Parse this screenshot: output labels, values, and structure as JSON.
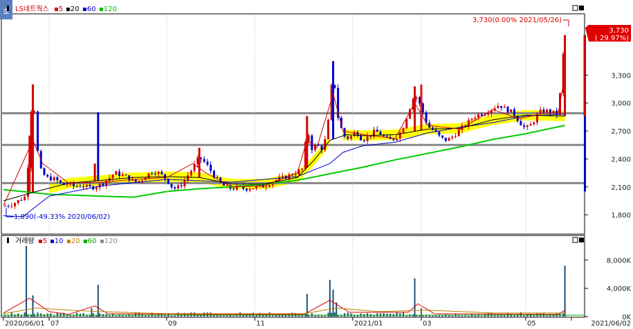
{
  "chart_data": [
    {
      "type": "candlestick",
      "title": "LS네트웍스",
      "legend": [
        {
          "label": "LS네트웍스",
          "color": "#d40000"
        },
        {
          "label": "5",
          "color": "#d40000"
        },
        {
          "label": "20",
          "color": "#000000"
        },
        {
          "label": "60",
          "color": "#0000cc"
        },
        {
          "label": "120",
          "color": "#00bb00"
        }
      ],
      "ylim": [
        1600,
        3950
      ],
      "yticks": [
        {
          "label": "3,300",
          "value": 3300
        },
        {
          "label": "3,000",
          "value": 3000
        },
        {
          "label": "2,700",
          "value": 2700
        },
        {
          "label": "2,400",
          "value": 2400
        },
        {
          "label": "2,100",
          "value": 2100
        },
        {
          "label": "1,800",
          "value": 1800
        }
      ],
      "last_price": {
        "value": "3,730",
        "change": "( 29.97%)",
        "numeric": 3730
      },
      "max_annotation": "3,730(0.00% 2021/05/26)",
      "min_annotation": "1,890(-49.33% 2020/06/02)",
      "horizontal_lines": [
        2890,
        2550,
        2140
      ],
      "price_path": [
        [
          0,
          1890
        ],
        [
          3,
          1920
        ],
        [
          7,
          2000
        ],
        [
          8,
          2650
        ],
        [
          9,
          3200
        ],
        [
          10,
          2650
        ],
        [
          11,
          2300
        ],
        [
          13,
          2200
        ],
        [
          16,
          2180
        ],
        [
          18,
          2120
        ],
        [
          20,
          2130
        ],
        [
          22,
          2100
        ],
        [
          24,
          2120
        ],
        [
          26,
          2090
        ],
        [
          28,
          2100
        ],
        [
          30,
          2130
        ],
        [
          32,
          2180
        ],
        [
          34,
          2250
        ],
        [
          36,
          2230
        ],
        [
          38,
          2200
        ],
        [
          40,
          2150
        ],
        [
          42,
          2170
        ],
        [
          44,
          2230
        ],
        [
          46,
          2270
        ],
        [
          48,
          2240
        ],
        [
          50,
          2180
        ],
        [
          52,
          2080
        ],
        [
          54,
          2100
        ],
        [
          56,
          2200
        ],
        [
          58,
          2300
        ],
        [
          60,
          2420
        ],
        [
          62,
          2350
        ],
        [
          64,
          2250
        ],
        [
          66,
          2150
        ],
        [
          68,
          2100
        ],
        [
          70,
          2080
        ],
        [
          72,
          2100
        ],
        [
          74,
          2080
        ],
        [
          76,
          2090
        ],
        [
          78,
          2100
        ],
        [
          80,
          2110
        ],
        [
          82,
          2150
        ],
        [
          84,
          2180
        ],
        [
          86,
          2200
        ],
        [
          88,
          2230
        ],
        [
          90,
          2260
        ],
        [
          92,
          2300
        ],
        [
          93,
          2820
        ],
        [
          94,
          2500
        ],
        [
          96,
          2550
        ],
        [
          98,
          2500
        ],
        [
          100,
          2900
        ],
        [
          101,
          3450
        ],
        [
          102,
          2900
        ],
        [
          103,
          2800
        ],
        [
          104,
          2650
        ],
        [
          106,
          2620
        ],
        [
          108,
          2700
        ],
        [
          110,
          2600
        ],
        [
          112,
          2650
        ],
        [
          114,
          2700
        ],
        [
          116,
          2650
        ],
        [
          118,
          2600
        ],
        [
          120,
          2620
        ],
        [
          122,
          2700
        ],
        [
          124,
          2900
        ],
        [
          126,
          3100
        ],
        [
          128,
          2950
        ],
        [
          130,
          2750
        ],
        [
          132,
          2700
        ],
        [
          134,
          2620
        ],
        [
          136,
          2600
        ],
        [
          138,
          2650
        ],
        [
          140,
          2720
        ],
        [
          142,
          2780
        ],
        [
          144,
          2850
        ],
        [
          146,
          2880
        ],
        [
          148,
          2900
        ],
        [
          150,
          2950
        ],
        [
          152,
          2980
        ],
        [
          154,
          2930
        ],
        [
          156,
          2900
        ],
        [
          158,
          2800
        ],
        [
          160,
          2720
        ],
        [
          162,
          2780
        ],
        [
          164,
          2900
        ],
        [
          166,
          2920
        ],
        [
          168,
          2900
        ],
        [
          170,
          2880
        ],
        [
          172,
          3730
        ]
      ],
      "ma120_path": [
        [
          0,
          2070
        ],
        [
          14,
          2020
        ],
        [
          30,
          2000
        ],
        [
          40,
          1990
        ],
        [
          50,
          2050
        ],
        [
          60,
          2080
        ],
        [
          70,
          2100
        ],
        [
          80,
          2130
        ],
        [
          90,
          2170
        ],
        [
          100,
          2240
        ],
        [
          110,
          2310
        ],
        [
          120,
          2390
        ],
        [
          130,
          2460
        ],
        [
          140,
          2530
        ],
        [
          150,
          2610
        ],
        [
          160,
          2670
        ],
        [
          172,
          2760
        ]
      ],
      "ma60_path": [
        [
          0,
          1790
        ],
        [
          6,
          1780
        ],
        [
          14,
          2000
        ],
        [
          30,
          2110
        ],
        [
          50,
          2180
        ],
        [
          70,
          2150
        ],
        [
          90,
          2210
        ],
        [
          100,
          2350
        ],
        [
          104,
          2470
        ],
        [
          110,
          2540
        ],
        [
          120,
          2580
        ],
        [
          130,
          2680
        ],
        [
          140,
          2740
        ],
        [
          150,
          2790
        ],
        [
          160,
          2860
        ],
        [
          172,
          2880
        ]
      ],
      "ma20_path": [
        [
          0,
          1950
        ],
        [
          10,
          2050
        ],
        [
          20,
          2140
        ],
        [
          30,
          2170
        ],
        [
          40,
          2200
        ],
        [
          50,
          2210
        ],
        [
          60,
          2200
        ],
        [
          70,
          2130
        ],
        [
          80,
          2130
        ],
        [
          90,
          2200
        ],
        [
          95,
          2380
        ],
        [
          100,
          2600
        ],
        [
          105,
          2660
        ],
        [
          110,
          2650
        ],
        [
          120,
          2660
        ],
        [
          130,
          2720
        ],
        [
          140,
          2730
        ],
        [
          150,
          2820
        ],
        [
          160,
          2870
        ],
        [
          172,
          2860
        ]
      ],
      "ma5_path": [
        [
          0,
          1900
        ],
        [
          9,
          2600
        ],
        [
          12,
          2350
        ],
        [
          20,
          2140
        ],
        [
          30,
          2150
        ],
        [
          40,
          2180
        ],
        [
          50,
          2200
        ],
        [
          58,
          2350
        ],
        [
          62,
          2250
        ],
        [
          70,
          2100
        ],
        [
          80,
          2110
        ],
        [
          90,
          2250
        ],
        [
          93,
          2600
        ],
        [
          96,
          2520
        ],
        [
          101,
          3100
        ],
        [
          104,
          2700
        ],
        [
          112,
          2650
        ],
        [
          120,
          2620
        ],
        [
          126,
          3000
        ],
        [
          130,
          2760
        ],
        [
          140,
          2720
        ],
        [
          150,
          2930
        ],
        [
          158,
          2830
        ],
        [
          164,
          2880
        ],
        [
          170,
          2900
        ],
        [
          172,
          3300
        ]
      ],
      "spikes": [
        {
          "x": 8,
          "value": 2650
        },
        {
          "x": 9,
          "value": 3200
        },
        {
          "x": 28,
          "value": 2350
        },
        {
          "x": 29,
          "value": 2900
        },
        {
          "x": 60,
          "value": 2520
        },
        {
          "x": 93,
          "value": 2860
        },
        {
          "x": 101,
          "value": 3450
        },
        {
          "x": 126,
          "value": 3180
        },
        {
          "x": 128,
          "value": 3200
        },
        {
          "x": 172,
          "value": 3730
        }
      ],
      "volume_spike_up": {
        "from": 2050,
        "to": 3730
      }
    },
    {
      "type": "bar",
      "title": "거래량",
      "legend": [
        {
          "label": "거래량",
          "color": "#000000"
        },
        {
          "label": "5",
          "color": "#d40000"
        },
        {
          "label": "10",
          "color": "#0000cc"
        },
        {
          "label": "20",
          "color": "#c08000"
        },
        {
          "label": "60",
          "color": "#00aa00"
        },
        {
          "label": "120",
          "color": "#888888"
        }
      ],
      "ylim": [
        0,
        10000
      ],
      "yticks": [
        {
          "label": "8,000K",
          "value": 8000
        },
        {
          "label": "4,000K",
          "value": 4000
        },
        {
          "label": "0K",
          "value": 0
        }
      ],
      "volume_spikes": [
        {
          "x": 7,
          "value": 10000
        },
        {
          "x": 9,
          "value": 3000
        },
        {
          "x": 27,
          "value": 1200
        },
        {
          "x": 29,
          "value": 4500
        },
        {
          "x": 93,
          "value": 3200
        },
        {
          "x": 100,
          "value": 5200
        },
        {
          "x": 101,
          "value": 3800
        },
        {
          "x": 102,
          "value": 2000
        },
        {
          "x": 126,
          "value": 5400
        },
        {
          "x": 128,
          "value": 1200
        },
        {
          "x": 172,
          "value": 7200
        }
      ],
      "vol_ma5_path": [
        [
          0,
          500
        ],
        [
          8,
          2600
        ],
        [
          14,
          700
        ],
        [
          20,
          300
        ],
        [
          28,
          1500
        ],
        [
          32,
          400
        ],
        [
          60,
          300
        ],
        [
          92,
          300
        ],
        [
          100,
          2300
        ],
        [
          106,
          600
        ],
        [
          124,
          600
        ],
        [
          127,
          1800
        ],
        [
          132,
          400
        ],
        [
          170,
          300
        ],
        [
          172,
          900
        ]
      ],
      "vol_ma20_path": [
        [
          0,
          400
        ],
        [
          10,
          1200
        ],
        [
          20,
          900
        ],
        [
          30,
          700
        ],
        [
          50,
          400
        ],
        [
          92,
          400
        ],
        [
          102,
          1200
        ],
        [
          115,
          700
        ],
        [
          130,
          900
        ],
        [
          150,
          500
        ],
        [
          172,
          500
        ]
      ]
    }
  ],
  "x_axis": {
    "labels": [
      {
        "text": "2020/06/01",
        "x": 0
      },
      {
        "text": "07",
        "x": 14
      },
      {
        "text": "09",
        "x": 50
      },
      {
        "text": "11",
        "x": 77
      },
      {
        "text": "2021/01",
        "x": 107
      },
      {
        "text": "03",
        "x": 128
      },
      {
        "text": "05",
        "x": 160
      },
      {
        "text": "2021/06/02",
        "x": 174
      }
    ]
  },
  "icons": {
    "corner": "chart-menu-icon",
    "panel_controls": "panel-window-controls-icon"
  },
  "colors": {
    "up": "#d40000",
    "down": "#0000cc",
    "band": "#ffff00",
    "ma120": "#00cc00",
    "grid": "#888888"
  }
}
